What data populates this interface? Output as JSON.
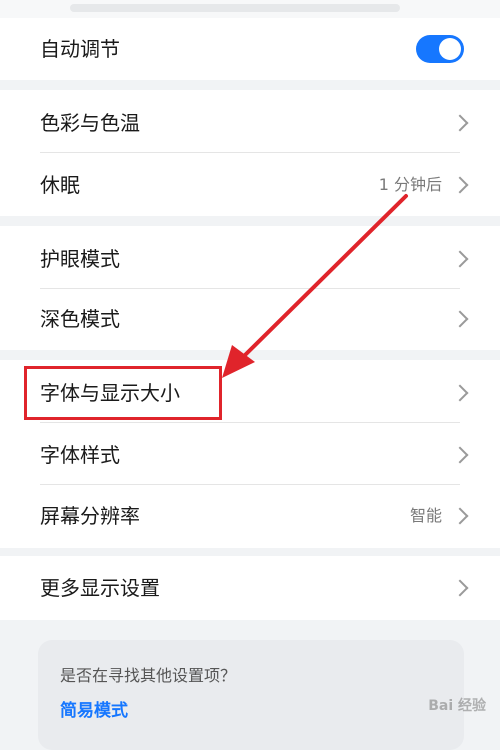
{
  "settings": {
    "auto_adjust": {
      "label": "自动调节",
      "enabled": true
    },
    "group1": [
      {
        "label": "色彩与色温",
        "value": ""
      },
      {
        "label": "休眠",
        "value": "1 分钟后"
      }
    ],
    "group2": [
      {
        "label": "护眼模式",
        "value": ""
      },
      {
        "label": "深色模式",
        "value": ""
      }
    ],
    "group3": [
      {
        "label": "字体与显示大小",
        "value": ""
      },
      {
        "label": "字体样式",
        "value": ""
      },
      {
        "label": "屏幕分辨率",
        "value": "智能"
      }
    ],
    "group4": [
      {
        "label": "更多显示设置",
        "value": ""
      }
    ]
  },
  "suggestion": {
    "question": "是否在寻找其他设置项？",
    "link": "简易模式"
  },
  "watermark": "Bai 经验",
  "colors": {
    "accent": "#1677ff",
    "annotation": "#e0242b"
  }
}
